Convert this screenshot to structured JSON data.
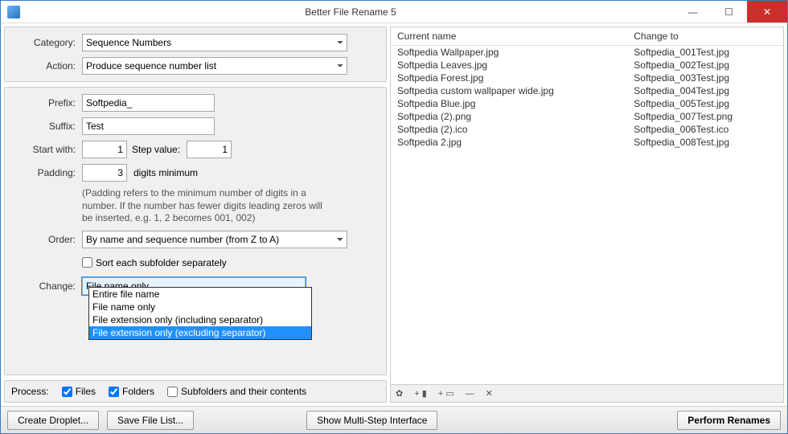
{
  "window": {
    "title": "Better File Rename 5"
  },
  "top": {
    "category_label": "Category:",
    "category_value": "Sequence Numbers",
    "action_label": "Action:",
    "action_value": "Produce sequence number list"
  },
  "form": {
    "prefix_label": "Prefix:",
    "prefix_value": "Softpedia_",
    "suffix_label": "Suffix:",
    "suffix_value": "Test",
    "start_label": "Start with:",
    "start_value": "1",
    "step_label": "Step value:",
    "step_value": "1",
    "padding_label": "Padding:",
    "padding_value": "3",
    "padding_suffix": "digits minimum",
    "padding_help": "(Padding refers to the minimum number of digits in a number. If the number has fewer digits leading zeros will be inserted, e.g. 1, 2 becomes 001, 002)",
    "order_label": "Order:",
    "order_value": "By name and sequence number (from Z to A)",
    "sort_subfolders_label": "Sort each subfolder separately",
    "change_label": "Change:",
    "change_value": "File name only",
    "change_options": [
      "Entire file name",
      "File name only",
      "File extension only (including separator)",
      "File extension only (excluding separator)"
    ]
  },
  "process": {
    "label": "Process:",
    "files_label": "Files",
    "folders_label": "Folders",
    "subfolders_label": "Subfolders and their contents"
  },
  "table": {
    "col_current": "Current name",
    "col_changeto": "Change to",
    "rows": [
      {
        "c": "Softpedia Wallpaper.jpg",
        "n": "Softpedia_001Test.jpg"
      },
      {
        "c": "Softpedia Leaves.jpg",
        "n": "Softpedia_002Test.jpg"
      },
      {
        "c": "Softpedia Forest.jpg",
        "n": "Softpedia_003Test.jpg"
      },
      {
        "c": "Softpedia custom wallpaper wide.jpg",
        "n": "Softpedia_004Test.jpg"
      },
      {
        "c": "Softpedia Blue.jpg",
        "n": "Softpedia_005Test.jpg"
      },
      {
        "c": "Softpedia (2).png",
        "n": "Softpedia_007Test.png"
      },
      {
        "c": "Softpedia (2).ico",
        "n": "Softpedia_006Test.ico"
      },
      {
        "c": "Softpedia 2.jpg",
        "n": "Softpedia_008Test.jpg"
      }
    ]
  },
  "buttons": {
    "create_droplet": "Create Droplet...",
    "save_list": "Save File List...",
    "multistep": "Show Multi-Step Interface",
    "perform": "Perform Renames"
  }
}
